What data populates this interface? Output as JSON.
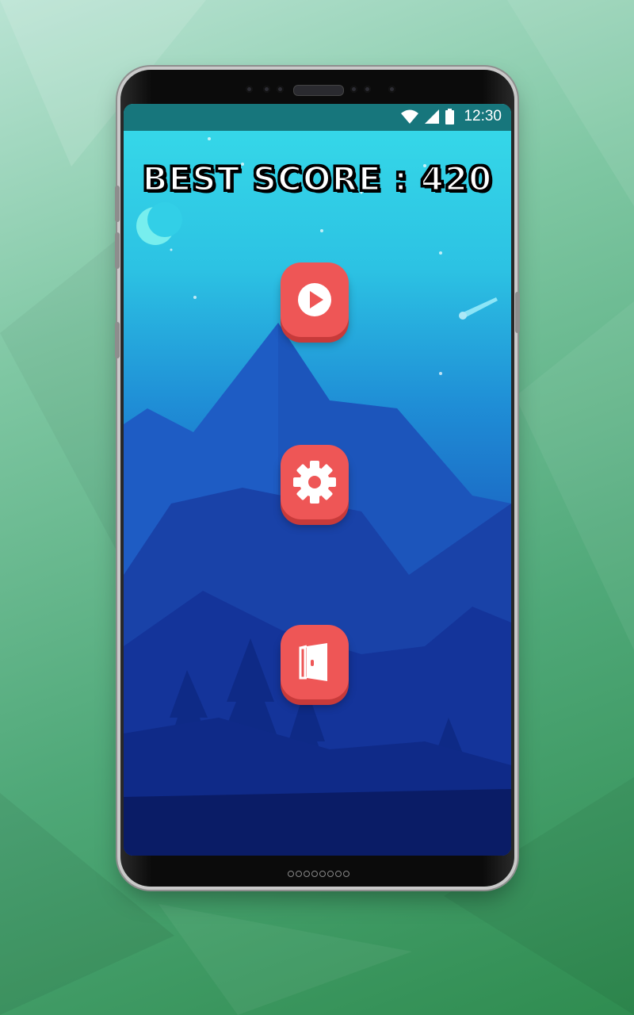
{
  "status_bar": {
    "time": "12:30",
    "icons": [
      "wifi-icon",
      "signal-icon",
      "battery-icon"
    ]
  },
  "game": {
    "best_score_label": "BEST SCORE : 420",
    "buttons": [
      {
        "name": "play-button",
        "icon": "play-icon"
      },
      {
        "name": "settings-button",
        "icon": "gear-icon"
      },
      {
        "name": "exit-button",
        "icon": "door-exit-icon"
      }
    ]
  },
  "colors": {
    "button_red": "#ee5656",
    "status_bar": "#17767c",
    "sky_top": "#37dbe9",
    "night_bottom": "#0b1a5c"
  }
}
